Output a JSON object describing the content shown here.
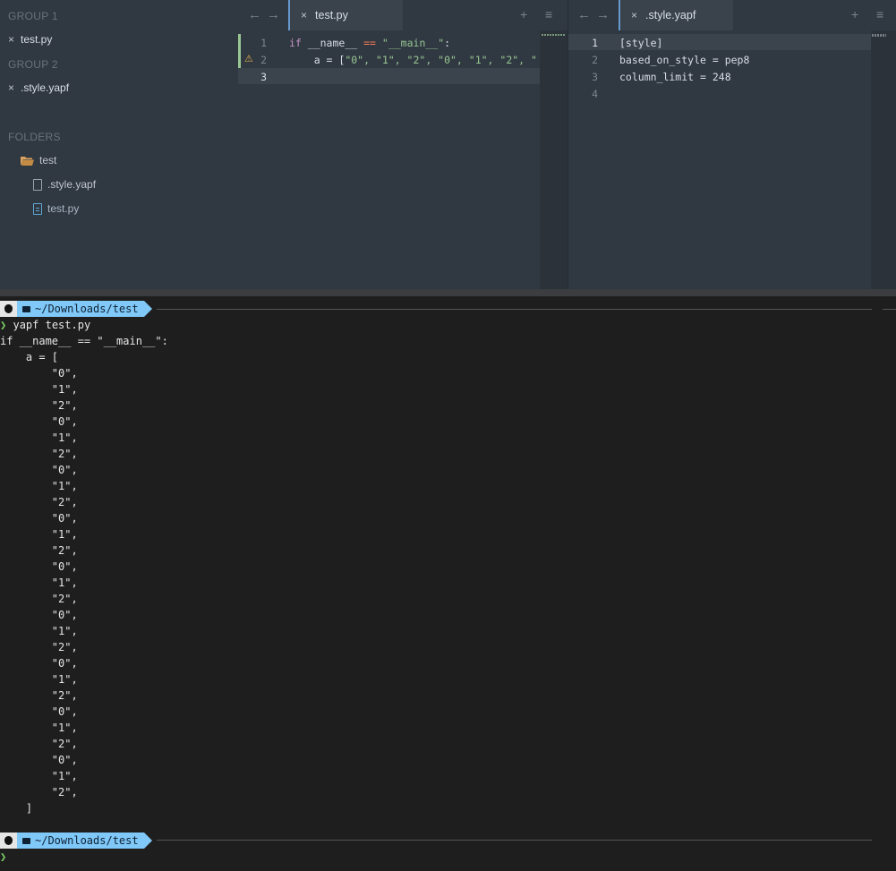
{
  "sidebar": {
    "group1_label": "GROUP 1",
    "group1_file": "test.py",
    "group2_label": "GROUP 2",
    "group2_file": ".style.yapf",
    "folders_label": "FOLDERS",
    "folder_name": "test",
    "files": [
      ".style.yapf",
      "test.py"
    ]
  },
  "left_pane": {
    "tab_label": "test.py",
    "line_numbers": [
      "1",
      "2",
      "3"
    ],
    "code": {
      "l1_kw": "if",
      "l1_name": " __name__ ",
      "l1_op": "==",
      "l1_str": "\"__main__\"",
      "l1_end": ":",
      "l2_prefix": "    a = [",
      "l2_items": "\"0\", \"1\", \"2\", \"0\", \"1\", \"2\", \""
    }
  },
  "right_pane": {
    "tab_label": ".style.yapf",
    "line_numbers": [
      "1",
      "2",
      "3",
      "4"
    ],
    "lines": [
      "[style]",
      "based_on_style = pep8",
      "column_limit = 248",
      ""
    ]
  },
  "icons": {
    "back": "←",
    "forward": "→",
    "plus": "+",
    "menu": "≡",
    "close": "×",
    "warning": "⚠"
  },
  "terminal": {
    "prompt_path": "~/Downloads/test",
    "command": "yapf test.py",
    "output": [
      "if __name__ == \"__main__\":",
      "    a = [",
      "        \"0\",",
      "        \"1\",",
      "        \"2\",",
      "        \"0\",",
      "        \"1\",",
      "        \"2\",",
      "        \"0\",",
      "        \"1\",",
      "        \"2\",",
      "        \"0\",",
      "        \"1\",",
      "        \"2\",",
      "        \"0\",",
      "        \"1\",",
      "        \"2\",",
      "        \"0\",",
      "        \"1\",",
      "        \"2\",",
      "        \"0\",",
      "        \"1\",",
      "        \"2\",",
      "        \"0\",",
      "        \"1\",",
      "        \"2\",",
      "        \"0\",",
      "        \"1\",",
      "        \"2\",",
      "    ]"
    ],
    "prompt_char": "❯"
  }
}
